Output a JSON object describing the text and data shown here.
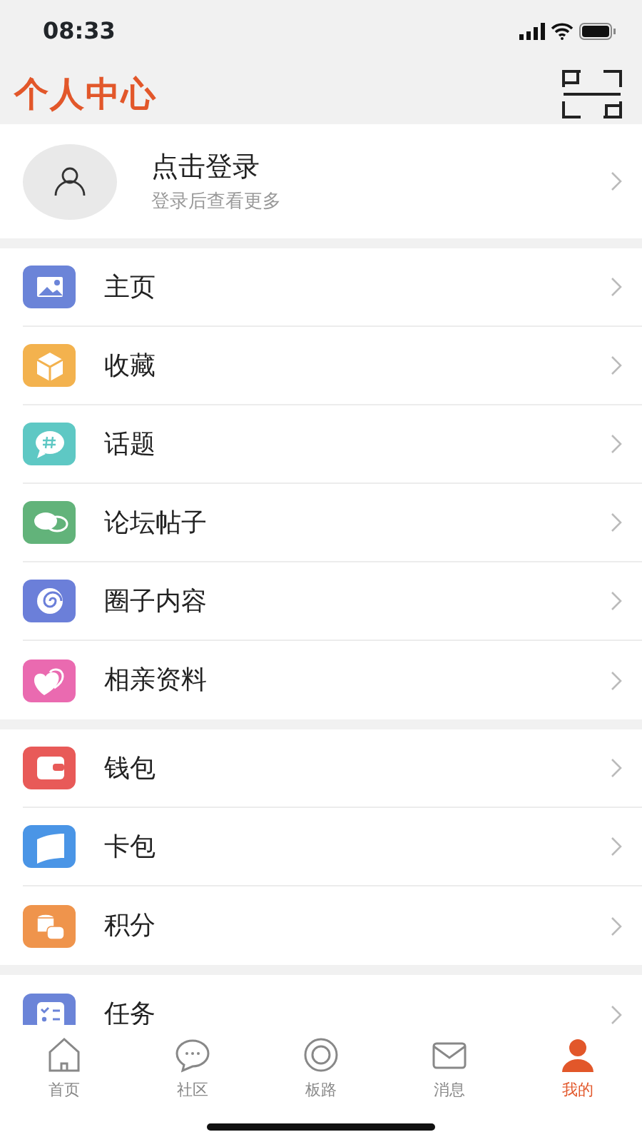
{
  "status_bar": {
    "time": "08:33"
  },
  "header": {
    "title": "个人中心"
  },
  "profile": {
    "name": "点击登录",
    "subtitle": "登录后查看更多"
  },
  "groups": [
    [
      {
        "label": "主页",
        "color": "#6b84d8"
      },
      {
        "label": "收藏",
        "color": "#f3b24e"
      },
      {
        "label": "话题",
        "color": "#5ec8c4"
      },
      {
        "label": "论坛帖子",
        "color": "#62b37a"
      },
      {
        "label": "圈子内容",
        "color": "#6b7fd9"
      },
      {
        "label": "相亲资料",
        "color": "#ea6ab0"
      }
    ],
    [
      {
        "label": "钱包",
        "color": "#e85a58"
      },
      {
        "label": "卡包",
        "color": "#4a95e6"
      },
      {
        "label": "积分",
        "color": "#ef944c"
      }
    ],
    [
      {
        "label": "任务",
        "color": "#6b84d8"
      }
    ]
  ],
  "tab_bar": [
    {
      "label": "首页",
      "selected": false
    },
    {
      "label": "社区",
      "selected": false
    },
    {
      "label": "板路",
      "selected": false
    },
    {
      "label": "消息",
      "selected": false
    },
    {
      "label": "我的",
      "selected": true
    }
  ]
}
